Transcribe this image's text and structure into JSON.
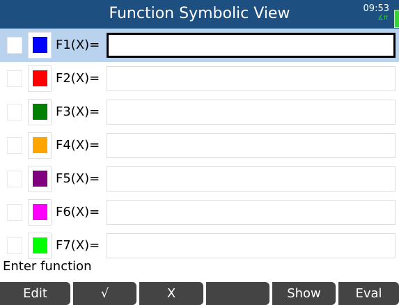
{
  "header": {
    "title": "Function Symbolic View",
    "time": "09:53",
    "angle_mode": "∡π"
  },
  "functions": [
    {
      "label": "F1(X)=",
      "color": "#0000ff",
      "value": ""
    },
    {
      "label": "F2(X)=",
      "color": "#ff0000",
      "value": ""
    },
    {
      "label": "F3(X)=",
      "color": "#008000",
      "value": ""
    },
    {
      "label": "F4(X)=",
      "color": "#ffa500",
      "value": ""
    },
    {
      "label": "F5(X)=",
      "color": "#800080",
      "value": ""
    },
    {
      "label": "F6(X)=",
      "color": "#ff00ff",
      "value": ""
    },
    {
      "label": "F7(X)=",
      "color": "#00ff00",
      "value": ""
    }
  ],
  "status": "Enter function",
  "softkeys": [
    "Edit",
    "√",
    "X",
    "",
    "Show",
    "Eval"
  ]
}
